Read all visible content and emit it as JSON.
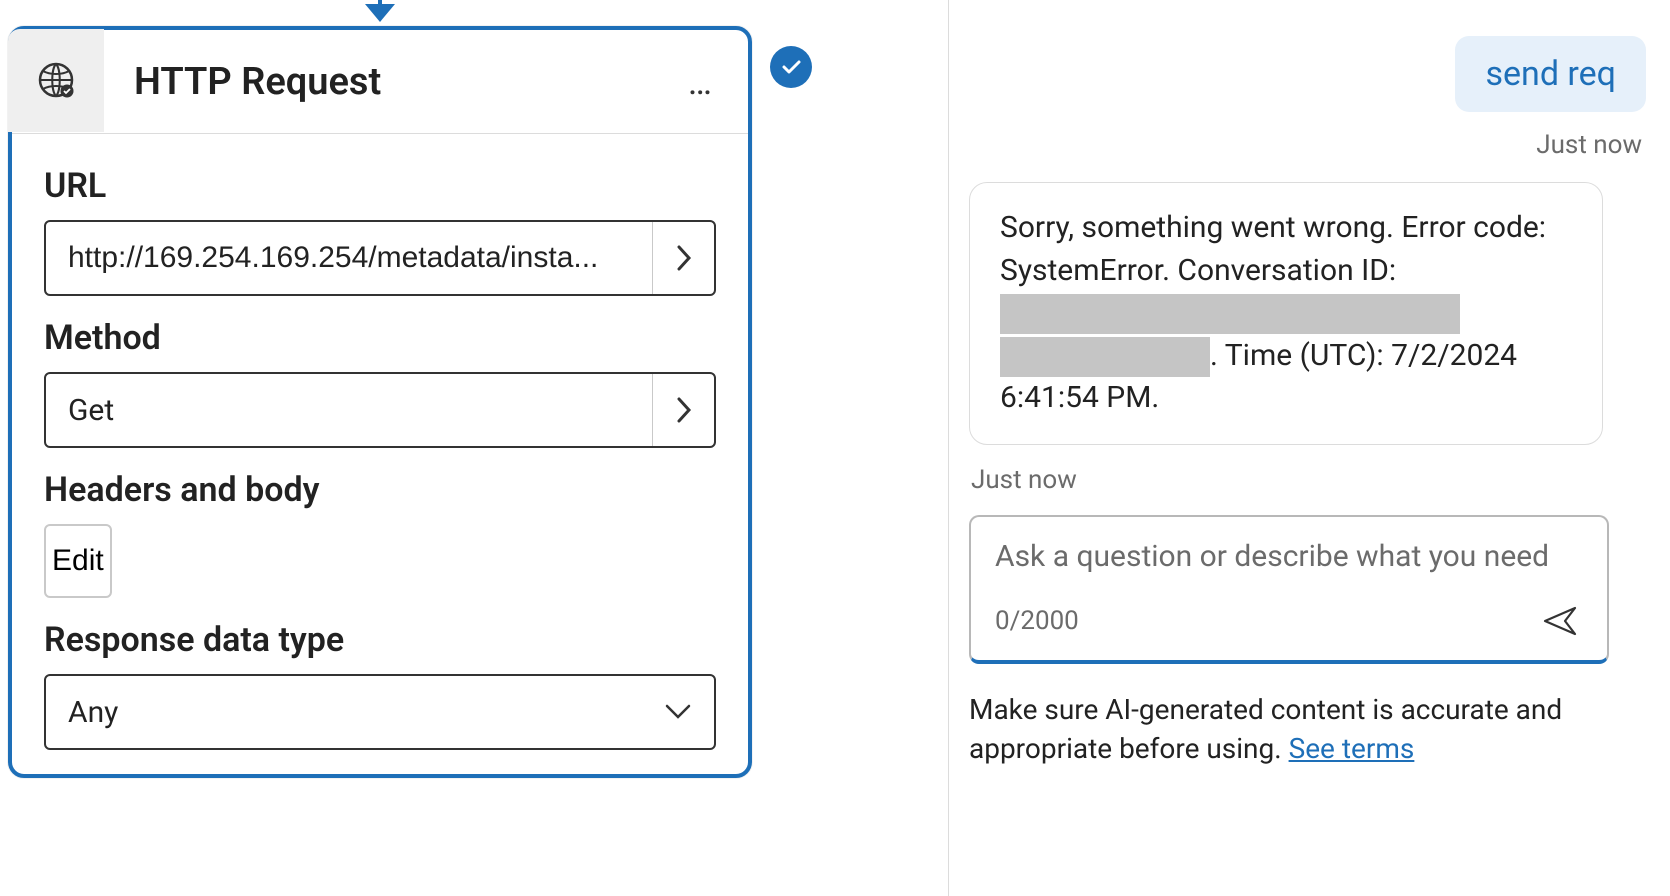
{
  "card": {
    "title": "HTTP Request",
    "fields": {
      "url_label": "URL",
      "url_value": "http://169.254.169.254/metadata/insta...",
      "method_label": "Method",
      "method_value": "Get",
      "headers_label": "Headers and body",
      "headers_button": "Edit",
      "response_label": "Response data type",
      "response_value": "Any"
    }
  },
  "chat": {
    "user_msg": "send req",
    "user_time": "Just now",
    "bot_msg_prefix": "Sorry, something went wrong. Error code: SystemError. Conversation ID: ",
    "bot_msg_suffix": ". Time (UTC): 7/2/2024 6:41:54 PM.",
    "bot_time": "Just now",
    "input_placeholder": "Ask a question or describe what you need",
    "char_counter": "0/2000",
    "disclaimer_text": "Make sure AI-generated content is accurate and appropriate before using. ",
    "disclaimer_link": "See terms"
  }
}
